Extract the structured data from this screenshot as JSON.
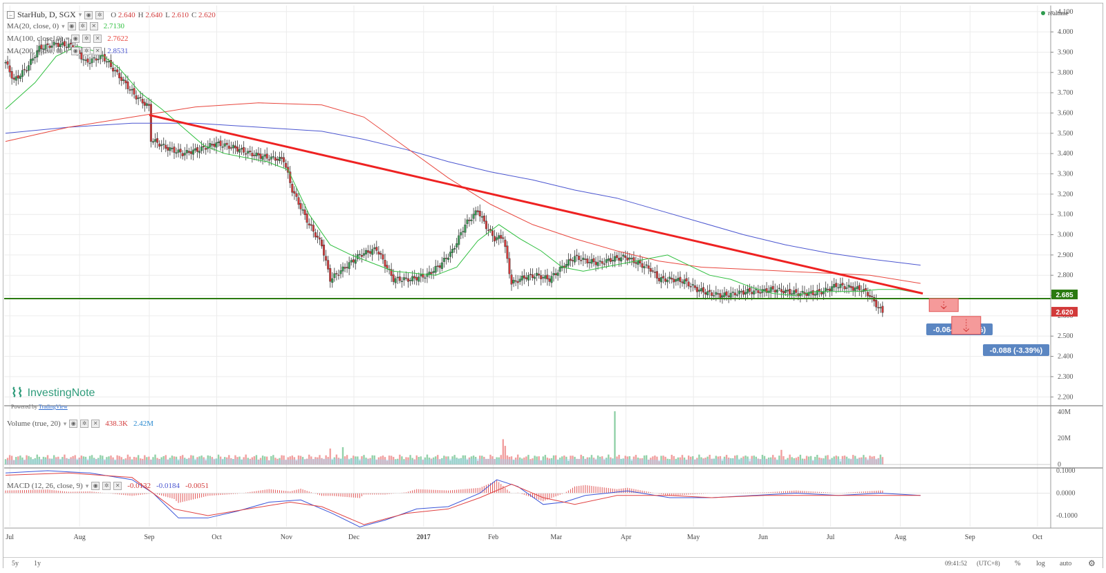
{
  "header": {
    "symbol": "StarHub",
    "interval": "D",
    "exchange": "SGX",
    "ohlc": [
      {
        "k": "O",
        "v": "2.640"
      },
      {
        "k": "H",
        "v": "2.640"
      },
      {
        "k": "L",
        "v": "2.610"
      },
      {
        "k": "C",
        "v": "2.620"
      }
    ],
    "realtime": "realtime"
  },
  "indicators": {
    "ma20": {
      "label": "MA(20, close, 0)",
      "value": "2.7130",
      "color": "#2fbf3f"
    },
    "ma100": {
      "label": "MA(100, close, 0)",
      "value": "2.7622",
      "color": "#e8453c"
    },
    "ma200": {
      "label": "MA(200, close, 0)",
      "value": "2.8531",
      "color": "#4a55d0"
    },
    "volume": {
      "label": "Volume (true, 20)",
      "value1": "438.3K",
      "value2": "2.42M"
    },
    "macd": {
      "label": "MACD (12, 26, close, 9)",
      "v1": "-0.0132",
      "v2": "-0.0184",
      "v3": "-0.0051"
    }
  },
  "branding": {
    "logo": "InvestingNote",
    "powered_prefix": "Powered by",
    "powered_link": "TradingView"
  },
  "colors": {
    "up": "#3a9a55",
    "down": "#d23a3a",
    "trend": "#ee2222",
    "support": "#2a7a10",
    "ma20": "#2fbf3f",
    "ma100": "#e8453c",
    "ma200": "#4a55d0",
    "label_bg": "#5b86c2"
  },
  "chart_data": {
    "type": "candlestick",
    "ylim": [
      2.15,
      4.12
    ],
    "price_ticks": [
      "4.100",
      "4.000",
      "3.900",
      "3.800",
      "3.700",
      "3.600",
      "3.500",
      "3.400",
      "3.300",
      "3.200",
      "3.100",
      "3.000",
      "2.900",
      "2.800",
      "2.700",
      "2.600",
      "2.500",
      "2.400",
      "2.300",
      "2.200"
    ],
    "volume_ticks": [
      "40M",
      "20M",
      "0"
    ],
    "macd_ticks": [
      "0.1000",
      "0.0000",
      "-0.1000"
    ],
    "x_labels": [
      "Jul",
      "Aug",
      "Sep",
      "Oct",
      "Nov",
      "Dec",
      "2017",
      "Feb",
      "Mar",
      "Apr",
      "May",
      "Jun",
      "Jul",
      "Aug",
      "Sep",
      "Oct"
    ],
    "current_price": "2.620",
    "support_price": "2.685",
    "support_level": 2.685,
    "trend_line": {
      "from": {
        "date": "2016-09-01",
        "price": 3.59
      },
      "to": {
        "date": "2017-08-11",
        "price": 2.71
      }
    },
    "ma20": [
      [
        0,
        3.62
      ],
      [
        14,
        3.75
      ],
      [
        24,
        3.88
      ],
      [
        34,
        3.93
      ],
      [
        44,
        3.9
      ],
      [
        54,
        3.82
      ],
      [
        64,
        3.7
      ],
      [
        74,
        3.62
      ],
      [
        84,
        3.53
      ],
      [
        94,
        3.44
      ],
      [
        104,
        3.4
      ],
      [
        114,
        3.38
      ],
      [
        124,
        3.36
      ],
      [
        134,
        3.32
      ],
      [
        144,
        3.1
      ],
      [
        154,
        2.95
      ],
      [
        164,
        2.9
      ],
      [
        174,
        2.86
      ],
      [
        184,
        2.82
      ],
      [
        194,
        2.81
      ],
      [
        204,
        2.8
      ],
      [
        214,
        2.84
      ],
      [
        224,
        2.97
      ],
      [
        234,
        3.05
      ],
      [
        244,
        2.98
      ],
      [
        254,
        2.92
      ],
      [
        264,
        2.84
      ],
      [
        274,
        2.82
      ],
      [
        284,
        2.84
      ],
      [
        294,
        2.86
      ],
      [
        304,
        2.88
      ],
      [
        314,
        2.9
      ],
      [
        324,
        2.85
      ],
      [
        334,
        2.8
      ],
      [
        344,
        2.78
      ],
      [
        354,
        2.74
      ],
      [
        364,
        2.71
      ],
      [
        374,
        2.7
      ],
      [
        384,
        2.72
      ],
      [
        394,
        2.72
      ],
      [
        404,
        2.72
      ],
      [
        414,
        2.73
      ],
      [
        424,
        2.73
      ],
      [
        434,
        2.71
      ]
    ],
    "ma100": [
      [
        0,
        3.46
      ],
      [
        30,
        3.53
      ],
      [
        60,
        3.58
      ],
      [
        90,
        3.63
      ],
      [
        120,
        3.65
      ],
      [
        150,
        3.64
      ],
      [
        170,
        3.58
      ],
      [
        190,
        3.43
      ],
      [
        210,
        3.28
      ],
      [
        230,
        3.15
      ],
      [
        250,
        3.05
      ],
      [
        270,
        2.98
      ],
      [
        290,
        2.92
      ],
      [
        310,
        2.87
      ],
      [
        330,
        2.84
      ],
      [
        350,
        2.83
      ],
      [
        370,
        2.82
      ],
      [
        390,
        2.81
      ],
      [
        410,
        2.8
      ],
      [
        434,
        2.76
      ]
    ],
    "ma200": [
      [
        0,
        3.5
      ],
      [
        30,
        3.53
      ],
      [
        60,
        3.55
      ],
      [
        90,
        3.55
      ],
      [
        120,
        3.53
      ],
      [
        150,
        3.51
      ],
      [
        170,
        3.47
      ],
      [
        190,
        3.42
      ],
      [
        210,
        3.36
      ],
      [
        230,
        3.31
      ],
      [
        250,
        3.27
      ],
      [
        270,
        3.22
      ],
      [
        290,
        3.18
      ],
      [
        310,
        3.12
      ],
      [
        330,
        3.06
      ],
      [
        350,
        3.0
      ],
      [
        370,
        2.95
      ],
      [
        390,
        2.91
      ],
      [
        410,
        2.88
      ],
      [
        434,
        2.85
      ]
    ],
    "macd_line": [
      [
        0,
        0.09
      ],
      [
        20,
        0.1
      ],
      [
        40,
        0.09
      ],
      [
        60,
        0.06
      ],
      [
        70,
        0.0
      ],
      [
        82,
        -0.11
      ],
      [
        96,
        -0.11
      ],
      [
        110,
        -0.08
      ],
      [
        125,
        -0.04
      ],
      [
        140,
        -0.03
      ],
      [
        155,
        -0.09
      ],
      [
        168,
        -0.15
      ],
      [
        180,
        -0.12
      ],
      [
        195,
        -0.07
      ],
      [
        210,
        -0.06
      ],
      [
        225,
        0.0
      ],
      [
        233,
        0.06
      ],
      [
        243,
        0.03
      ],
      [
        255,
        -0.05
      ],
      [
        265,
        -0.04
      ],
      [
        275,
        -0.01
      ],
      [
        295,
        0.01
      ],
      [
        315,
        -0.02
      ],
      [
        335,
        -0.02
      ],
      [
        355,
        -0.01
      ],
      [
        375,
        0.0
      ],
      [
        395,
        -0.01
      ],
      [
        415,
        0.0
      ],
      [
        434,
        -0.01
      ]
    ],
    "signal_line": [
      [
        0,
        0.08
      ],
      [
        30,
        0.09
      ],
      [
        60,
        0.07
      ],
      [
        80,
        -0.07
      ],
      [
        96,
        -0.1
      ],
      [
        115,
        -0.07
      ],
      [
        135,
        -0.04
      ],
      [
        150,
        -0.06
      ],
      [
        170,
        -0.14
      ],
      [
        190,
        -0.09
      ],
      [
        210,
        -0.07
      ],
      [
        225,
        -0.02
      ],
      [
        240,
        0.04
      ],
      [
        255,
        -0.02
      ],
      [
        270,
        -0.05
      ],
      [
        290,
        -0.01
      ],
      [
        315,
        -0.01
      ],
      [
        335,
        -0.02
      ],
      [
        360,
        -0.01
      ],
      [
        395,
        -0.01
      ],
      [
        434,
        -0.01
      ]
    ],
    "projections": [
      {
        "date": "2017-08-20",
        "label": "-0.064 (-2.41%)",
        "top": 2.685,
        "bottom": 2.621
      },
      {
        "date": "2017-08-30",
        "label": "-0.088 (-3.39%)",
        "top": 2.597,
        "bottom": 2.509
      }
    ],
    "volume_spikes": [
      {
        "date": "2017-03-17",
        "value": 40
      },
      {
        "date": "2017-01-25",
        "value": 14
      },
      {
        "date": "2017-05-30",
        "value": 9
      },
      {
        "date": "2016-11-20",
        "value": 11
      }
    ]
  },
  "bottom": {
    "left_buttons": [
      "5y",
      "1y"
    ],
    "time": "09:41:52",
    "tz": "(UTC+8)",
    "right_buttons": [
      "%",
      "log",
      "auto"
    ]
  }
}
